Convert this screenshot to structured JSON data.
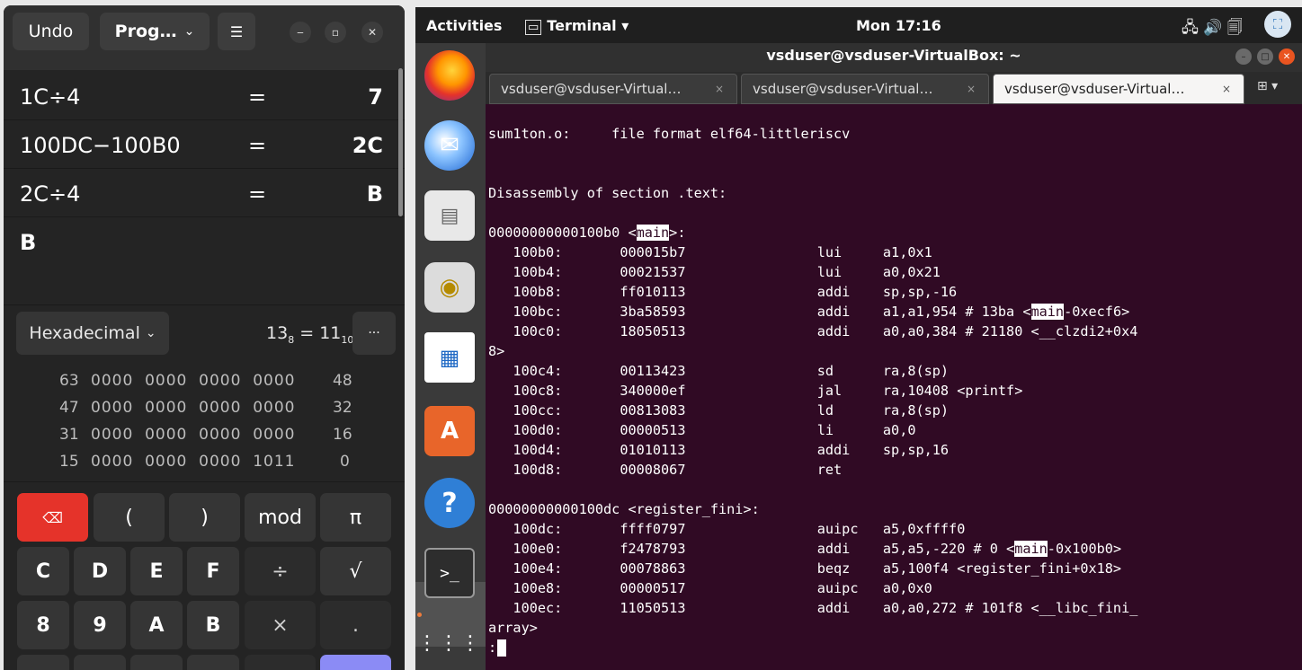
{
  "calculator": {
    "undo_label": "Undo",
    "mode_label": "Prog…",
    "mode_chevron": "⌄",
    "menu_icon": "☰",
    "history": [
      {
        "expr": "1C÷4",
        "eq": "=",
        "result": "7"
      },
      {
        "expr": "100DC−100B0",
        "eq": "=",
        "result": "2C"
      },
      {
        "expr": "2C÷4",
        "eq": "=",
        "result": "B"
      }
    ],
    "display": "B",
    "base_label": "Hexadecimal",
    "base_chevron": "⌄",
    "conv_a": "13",
    "conv_a_base": "8",
    "conv_eq": "=",
    "conv_b": "11",
    "conv_b_base": "10",
    "more_label": "···",
    "bits": [
      {
        "left": "63",
        "groups": "0000  0000  0000  0000",
        "right": "48"
      },
      {
        "left": "47",
        "groups": "0000  0000  0000  0000",
        "right": "32"
      },
      {
        "left": "31",
        "groups": "0000  0000  0000  0000",
        "right": "16"
      },
      {
        "left": "15",
        "groups": "0000  0000  0000  1011",
        "right": "0"
      }
    ],
    "keys": {
      "backspace": "⌫",
      "lparen": "(",
      "rparen": ")",
      "mod": "mod",
      "pi": "π",
      "c": "C",
      "d": "D",
      "e": "E",
      "f": "F",
      "divide": "÷",
      "sqrt": "√",
      "eight": "8",
      "nine": "9",
      "a": "A",
      "b": "B",
      "multiply": "×",
      "dot": "."
    },
    "accent_color": "#8b8bf5",
    "danger_color": "#e5332a"
  },
  "topbar": {
    "activities": "Activities",
    "app_name": "Terminal ▾",
    "clock": "Mon 17:16",
    "tray_icons": "🖧  🔊  🗐"
  },
  "terminal": {
    "title": "vsduser@vsduser-VirtualBox: ~",
    "tabs": [
      {
        "label": "vsduser@vsduser-Virtual…",
        "close": "×"
      },
      {
        "label": "vsduser@vsduser-Virtual…",
        "close": "×"
      },
      {
        "label": "vsduser@vsduser-Virtual…",
        "close": "×"
      }
    ],
    "lines": {
      "l1": "sum1ton.o:     file format elf64-littleriscv",
      "l2": "Disassembly of section .text:",
      "l3a": "00000000000100b0 <",
      "l3b": "main",
      "l3c": ">:",
      "l4": "   100b0:\t000015b7          \tlui\ta1,0x1",
      "l5": "   100b4:\t00021537          \tlui\ta0,0x21",
      "l6": "   100b8:\tff010113          \taddi\tsp,sp,-16",
      "l7a": "   100bc:\t3ba58593          \taddi\ta1,a1,954 # 13ba <",
      "l7b": "main",
      "l7c": "-0xecf6>",
      "l8": "   100c0:\t18050513          \taddi\ta0,a0,384 # 21180 <__clzdi2+0x4",
      "l9": "8>",
      "l10": "   100c4:\t00113423          \tsd\tra,8(sp)",
      "l11": "   100c8:\t340000ef          \tjal\tra,10408 <printf>",
      "l12": "   100cc:\t00813083          \tld\tra,8(sp)",
      "l13": "   100d0:\t00000513          \tli\ta0,0",
      "l14": "   100d4:\t01010113          \taddi\tsp,sp,16",
      "l15": "   100d8:\t00008067          \tret",
      "l16": "00000000000100dc <register_fini>:",
      "l17": "   100dc:\tffff0797          \tauipc\ta5,0xffff0",
      "l18a": "   100e0:\tf2478793          \taddi\ta5,a5,-220 # 0 <",
      "l18b": "main",
      "l18c": "-0x100b0>",
      "l19": "   100e4:\t00078863          \tbeqz\ta5,100f4 <register_fini+0x18>",
      "l20": "   100e8:\t00000517          \tauipc\ta0,0x0",
      "l21": "   100ec:\t11050513          \taddi\ta0,a0,272 # 101f8 <__libc_fini_",
      "l22": "array>",
      "l23": ":"
    },
    "background_color": "#300a24"
  }
}
